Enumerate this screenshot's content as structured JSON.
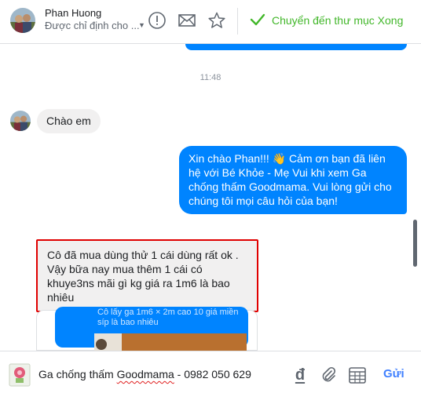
{
  "header": {
    "contact_name": "Phan Huong",
    "assign_label": "Được chỉ định cho ...",
    "done_label": "Chuyển đến thư mục Xong",
    "icons": [
      "avatar",
      "alert-circle-icon",
      "envelope-icon",
      "star-icon",
      "check-icon"
    ]
  },
  "conversation": {
    "timestamp": "11:48",
    "messages": [
      {
        "from": "customer",
        "text": "Chào em"
      },
      {
        "from": "page",
        "text": "Xin chào Phan!!! 👋 Cảm ơn bạn đã liên hệ với Bé Khỏe - Mẹ Vui khi xem Ga chống thấm Goodmama. Vui lòng gửi cho chúng tôi mọi câu hỏi của bạn!"
      },
      {
        "from": "customer",
        "text": "Cô đã mua dùng thử 1 cái dùng rất ok . Vậy bữa nay mua thêm 1 cái có khuye3ns mãi gì kg giá ra 1m6 là bao nhiêu",
        "highlighted": true
      }
    ],
    "attachment_caption": "Cô lấy ga 1m6 × 2m cao 10 giá miền síp là bao nhiêu"
  },
  "composer": {
    "text_before": "Ga chống thấm ",
    "text_misspelled": "Goodmama",
    "text_after": " - 0982 050 629",
    "currency_glyph": "đ",
    "send_label": "Gửi"
  },
  "colors": {
    "accent_blue": "#0084ff",
    "done_green": "#42b72a",
    "highlight_red": "#e00000",
    "send_blue": "#4080ff"
  }
}
